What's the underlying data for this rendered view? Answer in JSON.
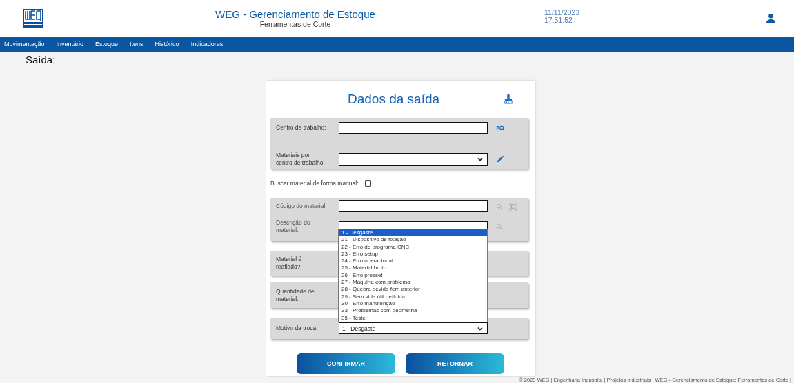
{
  "header": {
    "title": "WEG - Gerenciamento de Estoque",
    "subtitle": "Ferramentas de Corte",
    "date": "11/11/2023",
    "time": "17:51:52"
  },
  "nav": {
    "items": [
      "Movimentação",
      "Inventário",
      "Estoque",
      "Itens",
      "Histórico",
      "Indicadores"
    ]
  },
  "page_title": "Saída:",
  "form": {
    "title": "Dados da saída",
    "work_center": {
      "label": "Centro de trabalho:"
    },
    "materials_by_center": {
      "label": "Materiais por\ncentro de trabalho:"
    },
    "manual_search": {
      "label": "Buscar material de forma manual:",
      "checked": false
    },
    "material_code": {
      "label": "Código do material:",
      "disabled": true
    },
    "material_description": {
      "label": "Descrição do\nmaterial:",
      "disabled": true
    },
    "resharpened": {
      "label": "Material é\nreafiado?"
    },
    "quantity": {
      "label": "Quantidade de\nmaterial:"
    },
    "reason": {
      "label": "Motivo da troca:",
      "value": "1 - Desgaste",
      "expanded": true,
      "options": [
        {
          "label": "1 - Desgaste",
          "selected": true
        },
        {
          "label": "21 - Dispositivo de fixação",
          "selected": false
        },
        {
          "label": "22 - Erro de programa CNC",
          "selected": false
        },
        {
          "label": "23 - Erro setup",
          "selected": false
        },
        {
          "label": "24 - Erro operacional",
          "selected": false
        },
        {
          "label": "25 - Material bruto",
          "selected": false
        },
        {
          "label": "26 - Erro presset",
          "selected": false
        },
        {
          "label": "27 - Máquina com problema",
          "selected": false
        },
        {
          "label": "28 - Quebra devido ferr. anterior",
          "selected": false
        },
        {
          "label": "29 - Sem vida útil definida",
          "selected": false
        },
        {
          "label": "30 - Erro manutenção",
          "selected": false
        },
        {
          "label": "33 - Problemas com geometria",
          "selected": false
        },
        {
          "label": "35 - Teste",
          "selected": false
        }
      ]
    },
    "buttons": [
      "CONFIRMAR",
      "RETORNAR"
    ]
  },
  "footer": "© 2023 WEG | Engenharia Industrial | Projetos Industriais | WEG - Gerenciamento de Estoque: Ferramentas de Corte |"
}
